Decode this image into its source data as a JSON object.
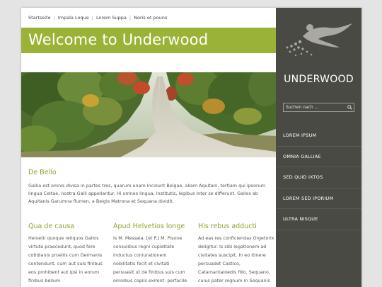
{
  "topnav": {
    "items": [
      "Startseite",
      "Impala Loque",
      "Lorem Suppa",
      "Noris et pouns"
    ]
  },
  "banner": {
    "title": "Welcome to Underwood"
  },
  "photo": {
    "icon": "forest-road-photo"
  },
  "intro": {
    "heading": "De Bello",
    "text": "Gallia est omnis divisa in partes tres, quarum unam incolunt Belgae, aliam Aquitani, tertiam qui ipsorum lingua Celtae, nostra Galli appellantur. Hi omnes lingua, institutis, legibus inter se differunt. Gallos ab Aquitanis Garumna flumen, a Belgis Matrona et Sequana dividit."
  },
  "columns": [
    {
      "heading": "Qua de causa",
      "text": "Helvetii quoque reliquos Gallos virtute praecedunt, quod fere cotidianis proeliis cum Germanis contendunt, cum aut suis finibus eos prohibent aut ipsi in eorum finibus bellum"
    },
    {
      "heading": "Apud Helvetios longe",
      "text": "Is M. Messala, [et P.] M. Pisone consulibus regni cupiditate inductus coniurationem nobilitatis fecit et civitati persuasit ut de finibus suis cum omnibus copiis exirent: perfacile"
    },
    {
      "heading": "His rebus adducti",
      "text": "Ad eas res conficiendas Orgetorix deligitur. Is sibi legationem ad civitates suscipit. In eo itinere persuadet Castico, Catamantaloedis filio, Sequano, cuius pater regnum in Sequanis"
    }
  ],
  "sidebar": {
    "logo_text": "UNDERWOOD",
    "search_placeholder": "Suchen nach ...",
    "menu": [
      "LOREM IPSUM",
      "OMNIA GALLIAE",
      "SED QUID IXTOS",
      "LOREM SED IPORIUM",
      "ULTRA NISQUE"
    ]
  },
  "colors": {
    "accent": "#9ab336",
    "sidebar": "#4a4a45",
    "background": "#e4e4e4"
  }
}
